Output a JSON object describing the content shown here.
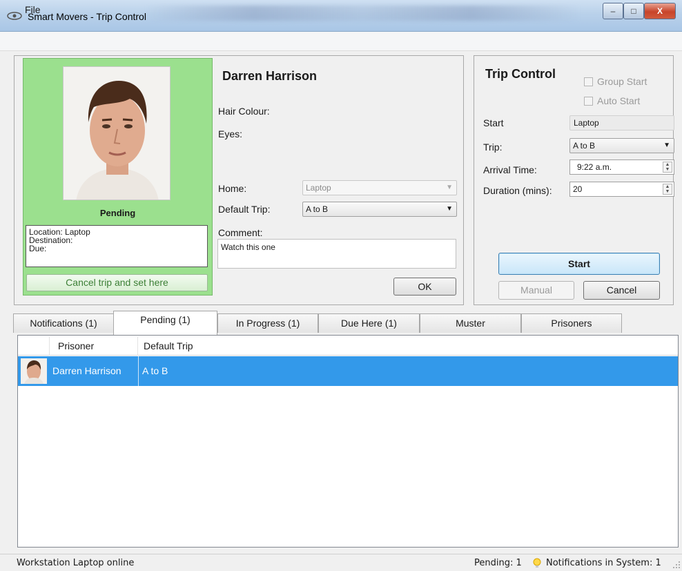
{
  "window": {
    "title": "Smart Movers - Trip Control",
    "controls": {
      "minimize": "–",
      "maximize": "□",
      "close": "X"
    }
  },
  "menu": {
    "file": "File"
  },
  "profile": {
    "status": "Pending",
    "location_lines": [
      "Location: Laptop",
      "Destination:",
      "Due:"
    ],
    "cancel_button": "Cancel trip and set here",
    "name": "Darren Harrison",
    "hair_label": "Hair Colour:",
    "eyes_label": "Eyes:",
    "home_label": "Home:",
    "home_value": "Laptop",
    "default_trip_label": "Default Trip:",
    "default_trip_value": "A to B",
    "comment_label": "Comment:",
    "comment_value": "Watch this one",
    "ok_button": "OK"
  },
  "trip_control": {
    "title": "Trip Control",
    "group_start": "Group Start",
    "auto_start": "Auto Start",
    "start_label": "Start",
    "start_value": "Laptop",
    "trip_label": "Trip:",
    "trip_value": "A to B",
    "arrival_label": "Arrival Time:",
    "arrival_value": "9:22 a.m.",
    "duration_label": "Duration (mins):",
    "duration_value": "20",
    "start_button": "Start",
    "manual_button": "Manual",
    "cancel_button": "Cancel"
  },
  "tabs": [
    "Notifications (1)",
    "Pending (1)",
    "In Progress (1)",
    "Due Here (1)",
    "Muster",
    "Prisoners"
  ],
  "grid": {
    "columns": [
      "Prisoner",
      "Default Trip"
    ],
    "rows": [
      {
        "prisoner": "Darren Harrison",
        "default_trip": "A to B"
      }
    ]
  },
  "statusbar": {
    "left": "Workstation Laptop online",
    "pending": "Pending: 1",
    "notifications": "Notifications in System: 1"
  },
  "colors": {
    "photo_panel": "#9be08e",
    "selection": "#3399ea",
    "cancel_text": "#3c7f35"
  }
}
